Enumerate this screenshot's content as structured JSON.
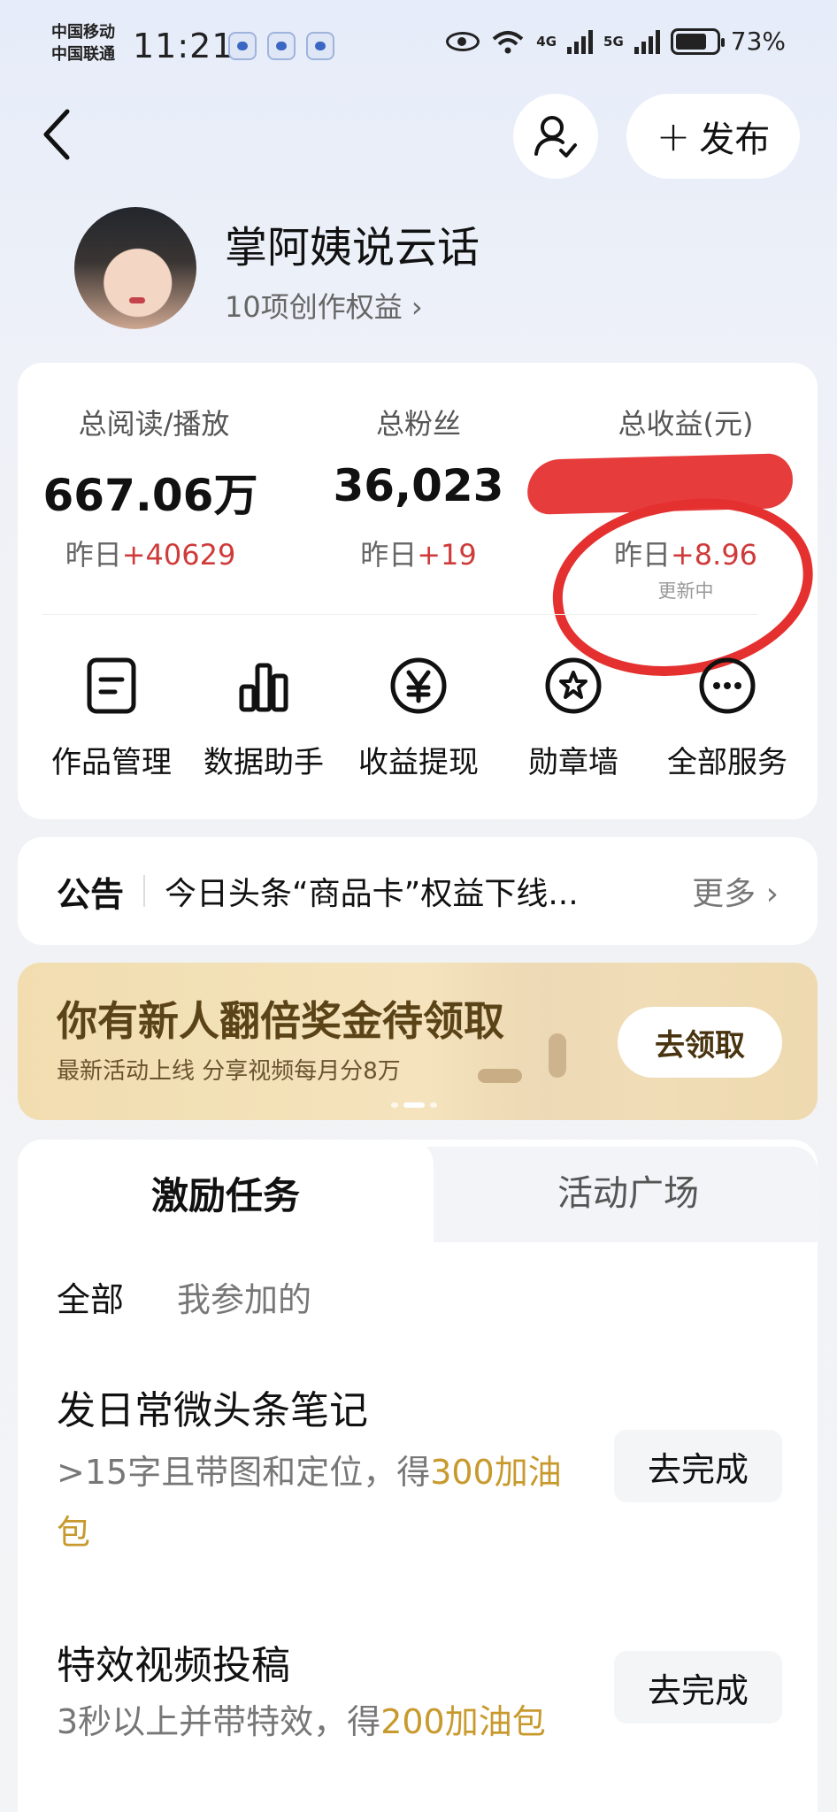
{
  "status_bar": {
    "carrier1": "中国移动",
    "carrier2": "中国联通",
    "time": "11:21",
    "net1": "4G",
    "net2": "5G",
    "battery": "73%"
  },
  "header": {
    "publish_label": "发布"
  },
  "profile": {
    "name": "掌阿姨说云话",
    "rights": "10项创作权益 ›"
  },
  "stats": {
    "reads": {
      "label": "总阅读/播放",
      "value": "667.06万",
      "delta_prefix": "昨日",
      "delta": "+40629"
    },
    "fans": {
      "label": "总粉丝",
      "value": "36,023",
      "delta_prefix": "昨日",
      "delta": "+19"
    },
    "income": {
      "label": "总收益(元)",
      "delta_prefix": "昨日",
      "delta": "+8.96",
      "status": "更新中"
    }
  },
  "services": [
    {
      "label": "作品管理",
      "icon": "document-icon"
    },
    {
      "label": "数据助手",
      "icon": "bar-chart-icon"
    },
    {
      "label": "收益提现",
      "icon": "yuan-icon"
    },
    {
      "label": "勋章墙",
      "icon": "medal-icon"
    },
    {
      "label": "全部服务",
      "icon": "more-icon"
    }
  ],
  "notice": {
    "tag": "公告",
    "message": "今日头条“商品卡”权益下线...",
    "more": "更多 ›"
  },
  "banner": {
    "title": "你有新人翻倍奖金待领取",
    "subtitle": "最新活动上线  分享视频每月分8万",
    "button": "去领取"
  },
  "tasks": {
    "tab_active": "激励任务",
    "tab_inactive": "活动广场",
    "filter_all": "全部",
    "filter_mine": "我参加的",
    "items": [
      {
        "title": "发日常微头条笔记",
        "desc": ">15字且带图和定位，得",
        "reward": "300加油包",
        "button": "去完成"
      },
      {
        "title": "特效视频投稿",
        "desc": "3秒以上并带特效，得",
        "reward": "200加油包",
        "button": "去完成"
      }
    ]
  },
  "colors": {
    "accent_red": "#cf3a3a",
    "reward_gold": "#c89a2e",
    "banner_bg": "#f1ddb0"
  }
}
